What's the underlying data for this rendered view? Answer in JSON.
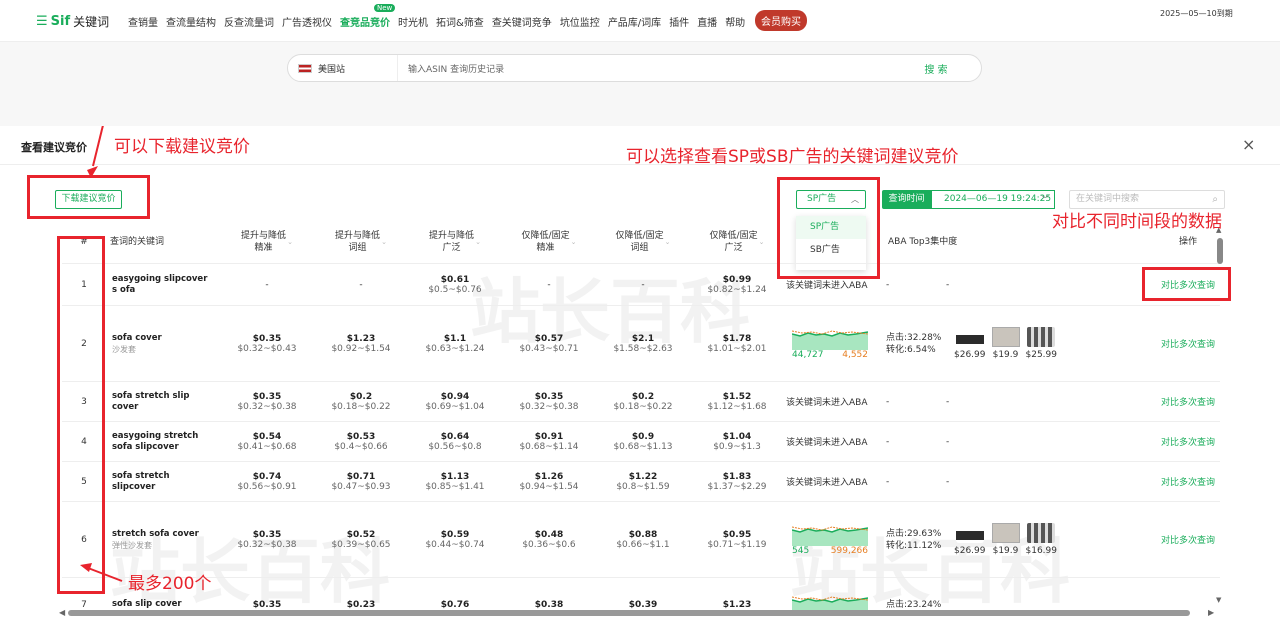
{
  "nav": {
    "logo_mark": "☰",
    "logo_brand": "Sif",
    "logo_text": "关键词",
    "items": [
      {
        "label": "查销量"
      },
      {
        "label": "查流量结构"
      },
      {
        "label": "反查流量词"
      },
      {
        "label": "广告透视仪"
      },
      {
        "label": "查竞品竞价",
        "badge": "New"
      },
      {
        "label": "时光机"
      },
      {
        "label": "拓词&筛查"
      },
      {
        "label": "查关键词竞争"
      },
      {
        "label": "坑位监控"
      },
      {
        "label": "产品库/词库"
      },
      {
        "label": "插件"
      },
      {
        "label": "直播"
      },
      {
        "label": "帮助"
      }
    ],
    "vip_label": "会员购买",
    "expiry": "2025—05—10到期"
  },
  "search": {
    "site": "美国站",
    "placeholder": "输入ASIN 查询历史记录",
    "button": "搜 索"
  },
  "modal": {
    "title": "查看建议竞价",
    "close": "×",
    "download_label": "下载建议竞价",
    "ad_type_selected": "SP广告",
    "ad_type_options": [
      "SP广告",
      "SB广告"
    ],
    "query_time_label": "查询时间",
    "query_time_value": "2024—06—19 19:24:25",
    "keyword_search_placeholder": "在关键词中搜索",
    "columns": {
      "index": "#",
      "keyword": "查词的关键词",
      "c1": [
        "提升与降低",
        "精准"
      ],
      "c2": [
        "提升与降低",
        "词组"
      ],
      "c3": [
        "提升与降低",
        "广泛"
      ],
      "c4": [
        "仅降低/固定",
        "精准"
      ],
      "c5": [
        "仅降低/固定",
        "词组"
      ],
      "c6": [
        "仅降低/固定",
        "广泛"
      ],
      "aba": "ABA Top3集中度",
      "op": "操作"
    },
    "rows": [
      {
        "idx": "1",
        "kw": "easygoing slipcover s ofa",
        "sub": "",
        "bids": [
          [
            "-",
            ""
          ],
          [
            "-",
            ""
          ],
          [
            "$0.61",
            "$0.5~$0.76"
          ],
          [
            "-",
            ""
          ],
          [
            "-",
            ""
          ],
          [
            "$0.99",
            "$0.82~$1.24"
          ]
        ],
        "aba": "该关键词未进入ABA",
        "conc": "-",
        "top": "-",
        "op": "对比多次查询"
      },
      {
        "idx": "2",
        "kw": "sofa cover",
        "sub": "沙发套",
        "bids": [
          [
            "$0.35",
            "$0.32~$0.43"
          ],
          [
            "$1.23",
            "$0.92~$1.54"
          ],
          [
            "$1.1",
            "$0.63~$1.24"
          ],
          [
            "$0.57",
            "$0.43~$0.71"
          ],
          [
            "$2.1",
            "$1.58~$2.63"
          ],
          [
            "$1.78",
            "$1.01~$2.01"
          ]
        ],
        "spark_left": "44,727",
        "spark_right": "4,552",
        "click": "点击:32.28%",
        "conv": "转化:6.54%",
        "prices": [
          "$26.99",
          "$19.9",
          "$25.99"
        ],
        "op": "对比多次查询"
      },
      {
        "idx": "3",
        "kw": "sofa stretch slip cover",
        "sub": "",
        "bids": [
          [
            "$0.35",
            "$0.32~$0.38"
          ],
          [
            "$0.2",
            "$0.18~$0.22"
          ],
          [
            "$0.94",
            "$0.69~$1.04"
          ],
          [
            "$0.35",
            "$0.32~$0.38"
          ],
          [
            "$0.2",
            "$0.18~$0.22"
          ],
          [
            "$1.52",
            "$1.12~$1.68"
          ]
        ],
        "aba": "该关键词未进入ABA",
        "conc": "-",
        "top": "-",
        "op": "对比多次查询"
      },
      {
        "idx": "4",
        "kw": "easygoing stretch sofa slipcover",
        "sub": "",
        "bids": [
          [
            "$0.54",
            "$0.41~$0.68"
          ],
          [
            "$0.53",
            "$0.4~$0.66"
          ],
          [
            "$0.64",
            "$0.56~$0.8"
          ],
          [
            "$0.91",
            "$0.68~$1.14"
          ],
          [
            "$0.9",
            "$0.68~$1.13"
          ],
          [
            "$1.04",
            "$0.9~$1.3"
          ]
        ],
        "aba": "该关键词未进入ABA",
        "conc": "-",
        "top": "-",
        "op": "对比多次查询"
      },
      {
        "idx": "5",
        "kw": "sofa stretch slipcover",
        "sub": "",
        "bids": [
          [
            "$0.74",
            "$0.56~$0.91"
          ],
          [
            "$0.71",
            "$0.47~$0.93"
          ],
          [
            "$1.13",
            "$0.85~$1.41"
          ],
          [
            "$1.26",
            "$0.94~$1.54"
          ],
          [
            "$1.22",
            "$0.8~$1.59"
          ],
          [
            "$1.83",
            "$1.37~$2.29"
          ]
        ],
        "aba": "该关键词未进入ABA",
        "conc": "-",
        "top": "-",
        "op": "对比多次查询"
      },
      {
        "idx": "6",
        "kw": "stretch sofa cover",
        "sub": "弹性沙发套",
        "bids": [
          [
            "$0.35",
            "$0.32~$0.38"
          ],
          [
            "$0.52",
            "$0.39~$0.65"
          ],
          [
            "$0.59",
            "$0.44~$0.74"
          ],
          [
            "$0.48",
            "$0.36~$0.6"
          ],
          [
            "$0.88",
            "$0.66~$1.1"
          ],
          [
            "$0.95",
            "$0.71~$1.19"
          ]
        ],
        "spark_left": "545",
        "spark_right": "599,266",
        "click": "点击:29.63%",
        "conv": "转化:11.12%",
        "prices": [
          "$26.99",
          "$19.9",
          "$16.99"
        ],
        "op": "对比多次查询"
      },
      {
        "idx": "7",
        "kw": "sofa slip cover",
        "bids": [
          [
            "$0.35"
          ],
          [
            "$0.23"
          ],
          [
            "$0.76"
          ],
          [
            "$0.38"
          ],
          [
            "$0.39"
          ],
          [
            "$1.23"
          ]
        ],
        "click": "点击:23.24%"
      }
    ]
  },
  "annotations": {
    "download": "可以下载建议竞价",
    "sp_sb": "可以选择查看SP或SB广告的关键词建议竞价",
    "compare": "对比不同时间段的数据",
    "max": "最多200个"
  },
  "watermark_text": "站长百科",
  "colors": {
    "accent": "#1aad5b",
    "annotation": "#e8242d",
    "orange": "#e67e22",
    "vip": "#c0392b"
  }
}
